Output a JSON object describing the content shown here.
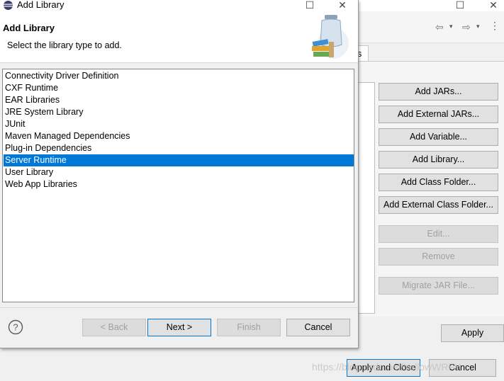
{
  "dialog": {
    "title": "Add Library",
    "header_title": "Add Library",
    "header_subtitle": "Select the library type to add.",
    "list": [
      {
        "label": "Connectivity Driver Definition",
        "selected": false
      },
      {
        "label": "CXF Runtime",
        "selected": false
      },
      {
        "label": "EAR Libraries",
        "selected": false
      },
      {
        "label": "JRE System Library",
        "selected": false
      },
      {
        "label": "JUnit",
        "selected": false
      },
      {
        "label": "Maven Managed Dependencies",
        "selected": false
      },
      {
        "label": "Plug-in Dependencies",
        "selected": false
      },
      {
        "label": "Server Runtime",
        "selected": true
      },
      {
        "label": "User Library",
        "selected": false
      },
      {
        "label": "Web App Libraries",
        "selected": false
      }
    ],
    "buttons": {
      "back": "< Back",
      "next": "Next >",
      "finish": "Finish",
      "cancel": "Cancel"
    },
    "help_icon": "question-mark",
    "selection_color": "#0078d7"
  },
  "background": {
    "tab_label": "es",
    "side_buttons": {
      "add_jars": "Add JARs...",
      "add_external_jars": "Add External JARs...",
      "add_variable": "Add Variable...",
      "add_library": "Add Library...",
      "add_class_folder": "Add Class Folder...",
      "add_external_class_folder": "Add External Class Folder...",
      "edit": "Edit...",
      "remove": "Remove",
      "migrate_jar": "Migrate JAR File..."
    },
    "apply": "Apply",
    "apply_and_close": "Apply and Close",
    "cancel": "Cancel"
  },
  "watermark": "https://blog.csdn.net/YellowWRFY"
}
